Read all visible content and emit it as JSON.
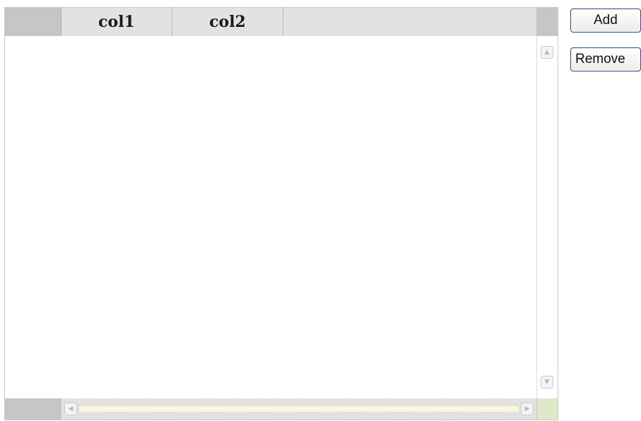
{
  "grid": {
    "columns": [
      {
        "header": "col1"
      },
      {
        "header": "col2"
      }
    ],
    "rows": [],
    "scroll_icons": {
      "up": "▲",
      "down": "▼",
      "left": "◀",
      "right": "▶"
    }
  },
  "actions": {
    "add_label": "Add",
    "remove_label": "Remove"
  }
}
